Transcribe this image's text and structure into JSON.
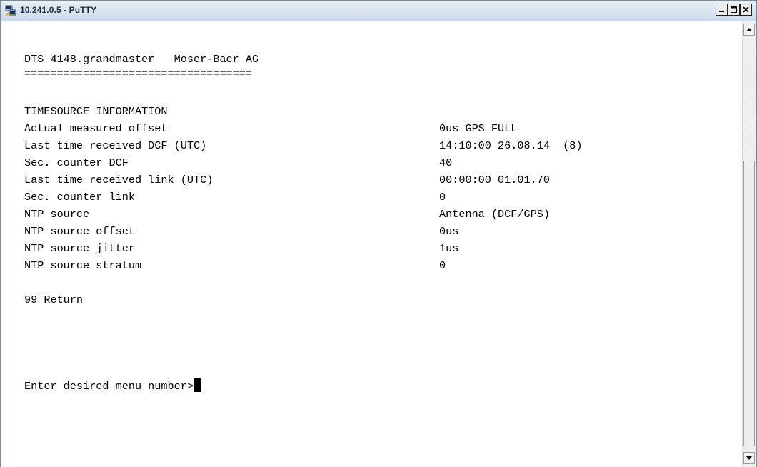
{
  "window": {
    "title": "10.241.0.5 - PuTTY",
    "icons": [
      "putty-icon",
      "minimize-icon",
      "maximize-icon",
      "close-icon"
    ]
  },
  "terminal": {
    "header": "DTS 4148.grandmaster   Moser-Baer AG",
    "separator": "===================================",
    "section_title": "TIMESOURCE INFORMATION",
    "rows": [
      {
        "label": "Actual measured offset",
        "value": "0us GPS FULL"
      },
      {
        "label": "Last time received DCF (UTC)",
        "value": "14:10:00 26.08.14  (8)"
      },
      {
        "label": "Sec. counter DCF",
        "value": "40"
      },
      {
        "label": "Last time received link (UTC)",
        "value": "00:00:00 01.01.70"
      },
      {
        "label": "Sec. counter link",
        "value": "0"
      },
      {
        "label": "NTP source",
        "value": "Antenna (DCF/GPS)"
      },
      {
        "label": "NTP source offset",
        "value": "0us"
      },
      {
        "label": "NTP source jitter",
        "value": "1us"
      },
      {
        "label": "NTP source stratum",
        "value": "0"
      }
    ],
    "return_item": "99 Return",
    "prompt": "Enter desired menu number>"
  },
  "colors": {
    "terminal_background": "#ffffff",
    "terminal_text": "#000000",
    "titlebar": "#dbe6f1"
  }
}
